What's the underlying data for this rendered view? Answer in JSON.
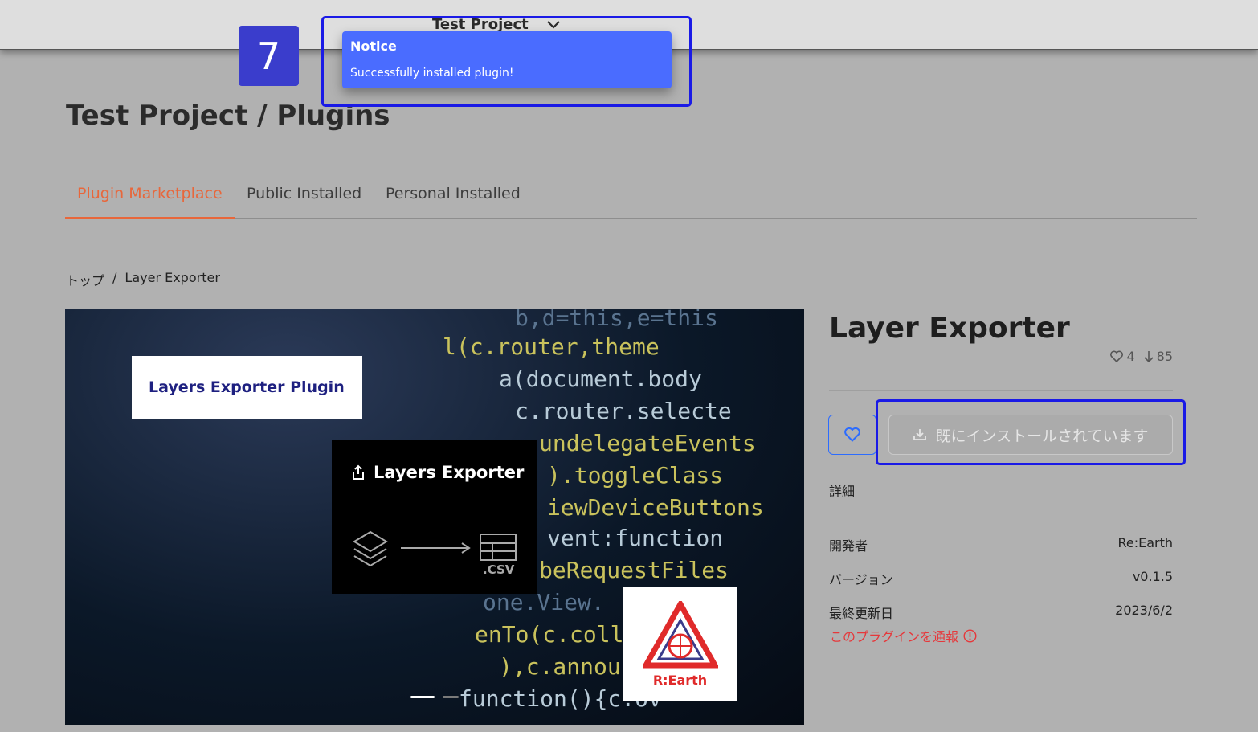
{
  "header": {
    "project_name": "Test Project"
  },
  "step_badge": "7",
  "notice": {
    "title": "Notice",
    "message": "Successfully installed plugin!"
  },
  "page_title": "Test Project / Plugins",
  "tabs": [
    {
      "label": "Plugin Marketplace",
      "active": true
    },
    {
      "label": "Public Installed",
      "active": false
    },
    {
      "label": "Personal Installed",
      "active": false
    }
  ],
  "breadcrumb": {
    "home": "トップ",
    "separator": "/",
    "current": "Layer Exporter"
  },
  "hero": {
    "card_white_text": "Layers Exporter Plugin",
    "card_black_title": "Layers Exporter",
    "csv_label": ".CSV",
    "logo_text": "R:Earth",
    "code_lines": [
      "b,d=this,e=this",
      "l(c.router,theme",
      "a(document.body",
      "c.router.selecte",
      "undelegateEvents",
      ").toggleClass",
      "iewDeviceButtons",
      "vent:function",
      "beRequestFiles",
      "one.View.",
      "enTo(c.collec",
      "),c.announ",
      "function(){c.ov"
    ],
    "slide_count": 2,
    "active_slide": 0
  },
  "plugin": {
    "name": "Layer Exporter",
    "likes": "4",
    "downloads": "85",
    "install_label": "既にインストールされています",
    "details_label": "詳細",
    "meta": [
      {
        "label": "開発者",
        "value": "Re:Earth"
      },
      {
        "label": "バージョン",
        "value": "v0.1.5"
      },
      {
        "label": "最終更新日",
        "value": "2023/6/2"
      }
    ],
    "report_label": "このプラグインを通報"
  },
  "colors": {
    "accent": "#e8673b",
    "notice_bg": "#4a6cff",
    "highlight": "#1a1ae6",
    "badge": "#3a3dcc",
    "danger": "#e6373a"
  }
}
